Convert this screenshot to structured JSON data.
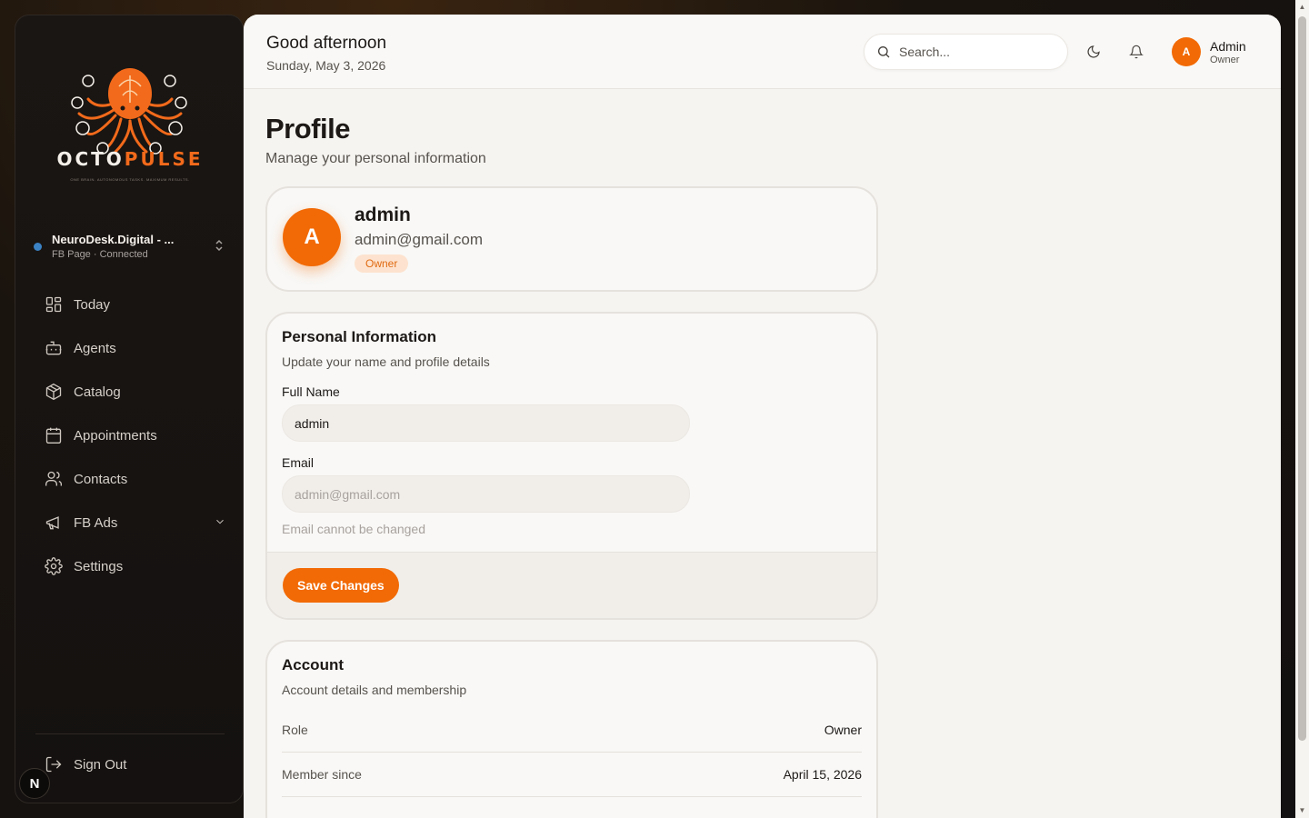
{
  "brand": {
    "name_part1": "OCTO",
    "name_part2": "PULSE",
    "tagline": "ONE BRAIN. AUTONOMOUS TASKS. MAXIMUM RESULTS."
  },
  "page_switcher": {
    "name": "NeuroDesk.Digital - ...",
    "status": "FB Page · Connected"
  },
  "sidebar": {
    "items": [
      {
        "label": "Today",
        "icon": "grid-icon"
      },
      {
        "label": "Agents",
        "icon": "bot-icon"
      },
      {
        "label": "Catalog",
        "icon": "package-icon"
      },
      {
        "label": "Appointments",
        "icon": "calendar-icon"
      },
      {
        "label": "Contacts",
        "icon": "users-icon"
      },
      {
        "label": "FB Ads",
        "icon": "megaphone-icon"
      },
      {
        "label": "Settings",
        "icon": "gear-icon"
      }
    ],
    "sign_out": "Sign Out",
    "badge": "N"
  },
  "header": {
    "greeting": "Good afternoon",
    "date": "Sunday, May 3, 2026",
    "search_placeholder": "Search...",
    "user_initial": "A",
    "user_name": "Admin",
    "user_role": "Owner"
  },
  "page": {
    "title": "Profile",
    "subtitle": "Manage your personal information"
  },
  "profile_card": {
    "initial": "A",
    "name": "admin",
    "email": "admin@gmail.com",
    "badge": "Owner"
  },
  "personal_info": {
    "title": "Personal Information",
    "subtitle": "Update your name and profile details",
    "full_name_label": "Full Name",
    "full_name_value": "admin",
    "email_label": "Email",
    "email_value": "admin@gmail.com",
    "email_hint": "Email cannot be changed",
    "save_label": "Save Changes"
  },
  "account": {
    "title": "Account",
    "subtitle": "Account details and membership",
    "rows": [
      {
        "key": "Role",
        "value": "Owner"
      },
      {
        "key": "Member since",
        "value": "April 15, 2026"
      }
    ]
  },
  "colors": {
    "accent": "#f26a05",
    "sidebar_bg": "#1a1613",
    "main_bg": "#f6f4f1"
  }
}
